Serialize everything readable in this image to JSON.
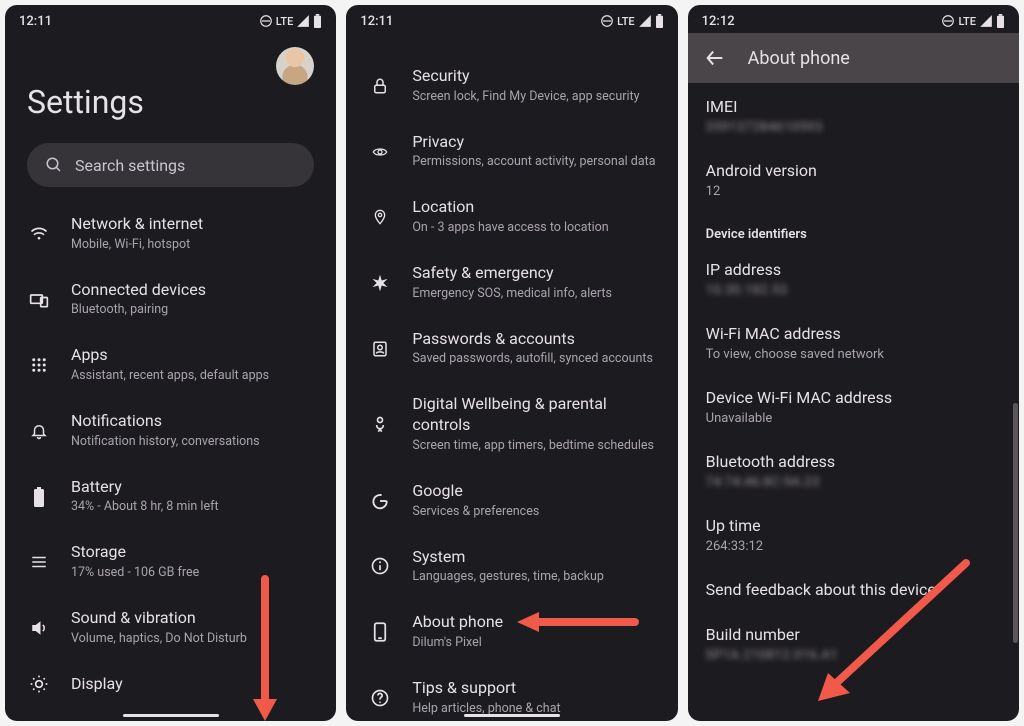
{
  "status": {
    "time_a": "12:11",
    "time_b": "12:11",
    "time_c": "12:12",
    "net": "LTE"
  },
  "screen1": {
    "title": "Settings",
    "search_placeholder": "Search settings",
    "items": [
      {
        "title": "Network & internet",
        "sub": "Mobile, Wi-Fi, hotspot"
      },
      {
        "title": "Connected devices",
        "sub": "Bluetooth, pairing"
      },
      {
        "title": "Apps",
        "sub": "Assistant, recent apps, default apps"
      },
      {
        "title": "Notifications",
        "sub": "Notification history, conversations"
      },
      {
        "title": "Battery",
        "sub": "34% - About 8 hr, 8 min left"
      },
      {
        "title": "Storage",
        "sub": "17% used - 106 GB free"
      },
      {
        "title": "Sound & vibration",
        "sub": "Volume, haptics, Do Not Disturb"
      },
      {
        "title": "Display",
        "sub": ""
      }
    ]
  },
  "screen2": {
    "items": [
      {
        "title": "Security",
        "sub": "Screen lock, Find My Device, app security"
      },
      {
        "title": "Privacy",
        "sub": "Permissions, account activity, personal data"
      },
      {
        "title": "Location",
        "sub": "On - 3 apps have access to location"
      },
      {
        "title": "Safety & emergency",
        "sub": "Emergency SOS, medical info, alerts"
      },
      {
        "title": "Passwords & accounts",
        "sub": "Saved passwords, autofill, synced accounts"
      },
      {
        "title": "Digital Wellbeing & parental controls",
        "sub": "Screen time, app timers, bedtime schedules"
      },
      {
        "title": "Google",
        "sub": "Services & preferences"
      },
      {
        "title": "System",
        "sub": "Languages, gestures, time, backup"
      },
      {
        "title": "About phone",
        "sub": "Dilum's Pixel"
      },
      {
        "title": "Tips & support",
        "sub": "Help articles, phone & chat"
      }
    ]
  },
  "screen3": {
    "appbar_title": "About phone",
    "imei_label": "IMEI",
    "imei_value": "359137284610593",
    "android_version_label": "Android version",
    "android_version_value": "12",
    "section_label": "Device identifiers",
    "ip_label": "IP address",
    "ip_value": "10.30.182.53",
    "wifi_mac_label": "Wi-Fi MAC address",
    "wifi_mac_value": "To view, choose saved network",
    "device_mac_label": "Device Wi-Fi MAC address",
    "device_mac_value": "Unavailable",
    "bt_label": "Bluetooth address",
    "bt_value": "74:74:46:8C:9A:23",
    "uptime_label": "Up time",
    "uptime_value": "264:33:12",
    "feedback_label": "Send feedback about this device",
    "build_label": "Build number",
    "build_value": "SP1A.210812.016.A1"
  }
}
